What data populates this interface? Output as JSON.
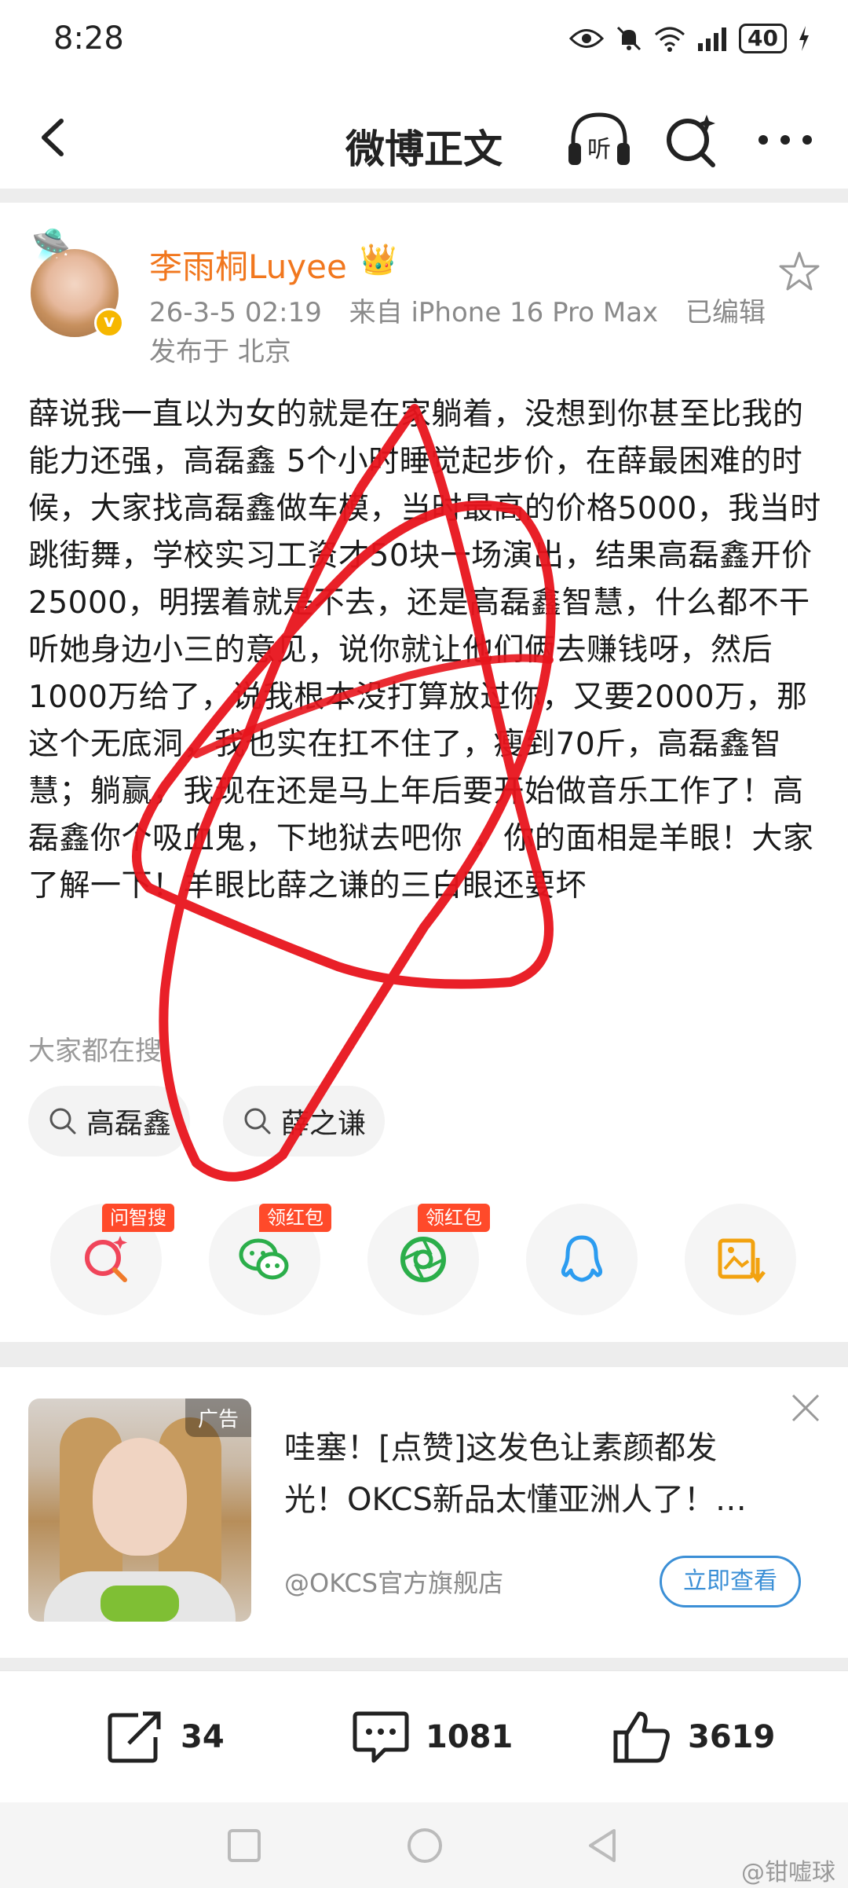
{
  "status_bar": {
    "time": "8:28",
    "battery": "40"
  },
  "nav": {
    "title": "微博正文",
    "listen_icon_text": "听"
  },
  "post": {
    "author": "李雨桐Luyee",
    "date": "26-3-5 02:19",
    "source": "来自 iPhone 16 Pro Max",
    "edited": "已编辑",
    "location": "发布于 北京",
    "text": "薛说我一直以为女的就是在家躺着，没想到你甚至比我的能力还强，高磊鑫 5个小时睡觉起步价，在薛最困难的时候，大家找高磊鑫做车模，当时最高的价格5000，我当时跳街舞，学校实习工资才50块一场演出，结果高磊鑫开价25000，明摆着就是不去，还是高磊鑫智慧，什么都不干听她身边小三的意见，说你就让他们俩去赚钱呀，然后1000万给了，说我根本没打算放过你，又要2000万，那这个无底洞，我也实在扛不住了，瘦到70斤，高磊鑫智慧；躺赢，我现在还是马上年后要开始做音乐工作了！高磊鑫你个吸血鬼，下地狱去吧你 ，你的面相是羊眼！大家了解一下！羊眼比薛之谦的三白眼还要坏",
    "search_hint": "大家都在搜",
    "chips": [
      "高磊鑫",
      "薛之谦"
    ],
    "action_tags": [
      "问智搜",
      "领红包",
      "领红包"
    ]
  },
  "ad": {
    "label": "广告",
    "text_line1": "哇塞！[点赞]这发色让素颜都发",
    "text_line2": "光！OKCS新品太懂亚洲人了！…",
    "source": "@OKCS官方旗舰店",
    "button": "立即查看"
  },
  "bottom": {
    "reposts": "34",
    "comments": "1081",
    "likes": "3619"
  },
  "watermark": "@钳嘘球",
  "colors": {
    "accent_orange": "#f1771e",
    "tag_red": "#ff4a2a",
    "link_blue": "#3b8fd6",
    "scribble_red": "#e8141c"
  }
}
